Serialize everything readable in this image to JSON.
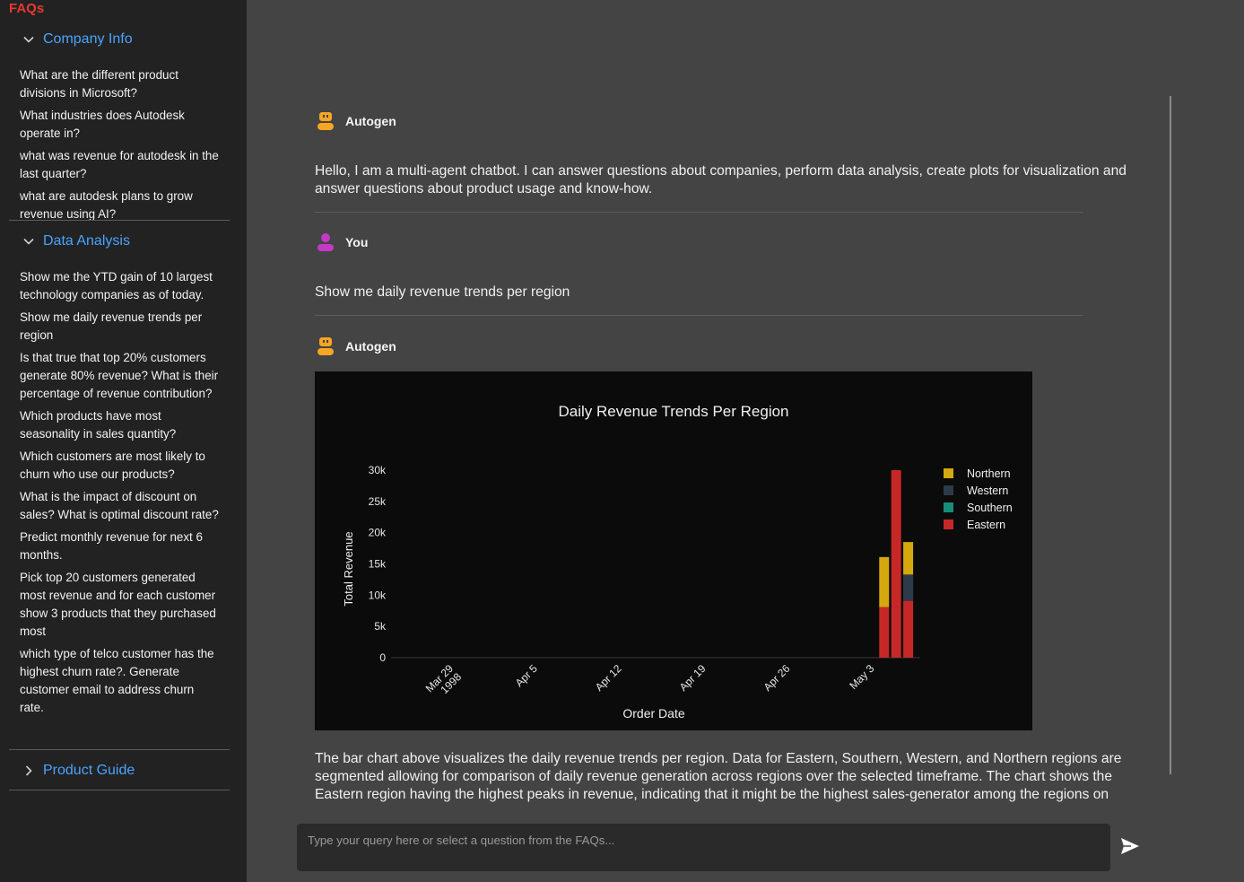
{
  "sidebar": {
    "title": "FAQs",
    "sections": [
      {
        "label": "Company Info",
        "expanded": true,
        "items": [
          "What are the different product divisions in Microsoft?",
          "What industries does Autodesk operate in?",
          "what was revenue for autodesk in the last quarter?",
          "what are autodesk plans to grow revenue using AI?"
        ]
      },
      {
        "label": "Data Analysis",
        "expanded": true,
        "items": [
          "Show me the YTD gain of 10 largest technology companies as of today.",
          "Show me daily revenue trends per region",
          "Is that true that top 20% customers generate 80% revenue? What is their percentage of revenue contribution?",
          "Which products have most seasonality in sales quantity?",
          "Which customers are most likely to churn who use our products?",
          "What is the impact of discount on sales? What is optimal discount rate?",
          "Predict monthly revenue for next 6 months.",
          "Pick top 20 customers generated most revenue and for each customer show 3 products that they purchased most",
          "which type of telco customer has the highest churn rate?. Generate customer email to address churn rate."
        ]
      },
      {
        "label": "Product Guide",
        "expanded": false,
        "items": []
      }
    ]
  },
  "chat": {
    "messages": [
      {
        "author": "Autogen",
        "role": "bot",
        "text": "Hello, I am a multi-agent chatbot. I can answer questions about companies, perform data analysis, create plots for visualization and answer questions about product usage and know-how."
      },
      {
        "author": "You",
        "role": "user",
        "text": "Show me daily revenue trends per region"
      },
      {
        "author": "Autogen",
        "role": "bot",
        "text": "The bar chart above visualizes the daily revenue trends per region. Data for Eastern, Southern, Western, and Northern regions are segmented allowing for comparison of daily revenue generation across regions over the selected timeframe. The chart shows the Eastern region having the highest peaks in revenue, indicating that it might be the highest sales-generator among the regions on"
      }
    ]
  },
  "input": {
    "placeholder": "Type your query here or select a question from the FAQs..."
  },
  "colors": {
    "Northern": "#d4a80e",
    "Western": "#2d3a4a",
    "Southern": "#1a8c7a",
    "Eastern": "#c62828",
    "accent": "#4aa3ff",
    "faq_title": "#e53935"
  },
  "chart_data": {
    "type": "bar",
    "stacked": true,
    "title": "Daily Revenue Trends Per Region",
    "xlabel": "Order Date",
    "ylabel": "Total Revenue",
    "x_ticks": [
      {
        "date": "1998-03-29",
        "label": [
          "Mar 29",
          "1998"
        ]
      },
      {
        "date": "1998-04-05",
        "label": [
          "Apr 5"
        ]
      },
      {
        "date": "1998-04-12",
        "label": [
          "Apr 12"
        ]
      },
      {
        "date": "1998-04-19",
        "label": [
          "Apr 19"
        ]
      },
      {
        "date": "1998-04-26",
        "label": [
          "Apr 26"
        ]
      },
      {
        "date": "1998-05-03",
        "label": [
          "May 3"
        ]
      }
    ],
    "y_ticks": [
      0,
      5000,
      10000,
      15000,
      20000,
      25000,
      30000
    ],
    "y_tick_labels": [
      "0",
      "5k",
      "10k",
      "15k",
      "20k",
      "25k",
      "30k"
    ],
    "ylim": [
      0,
      30000
    ],
    "xlim": [
      "1998-03-24",
      "1998-05-07"
    ],
    "legend_position": "top-right",
    "categories": [
      "1998-05-04",
      "1998-05-05",
      "1998-05-06"
    ],
    "series": [
      {
        "name": "Eastern",
        "values": [
          8100,
          30000,
          9100
        ]
      },
      {
        "name": "Southern",
        "values": [
          0,
          0,
          0
        ]
      },
      {
        "name": "Western",
        "values": [
          0,
          0,
          4200
        ]
      },
      {
        "name": "Northern",
        "values": [
          8000,
          0,
          5200
        ]
      }
    ],
    "legend_order": [
      "Northern",
      "Western",
      "Southern",
      "Eastern"
    ]
  }
}
